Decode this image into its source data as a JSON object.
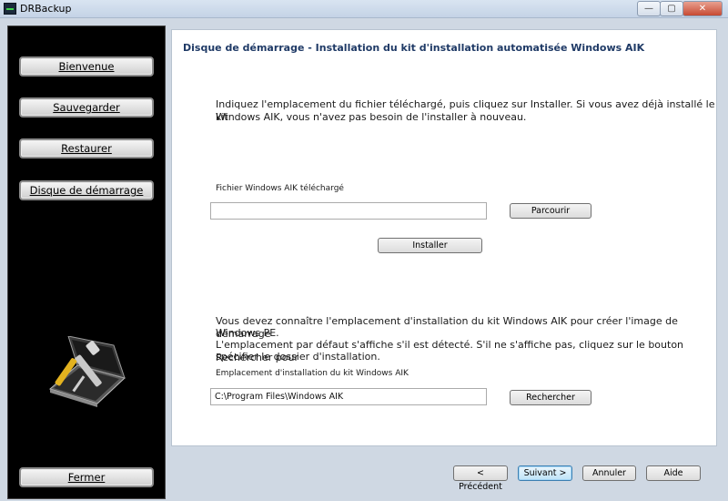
{
  "window": {
    "title": "DRBackup",
    "minimize": "—",
    "maximize": "▢",
    "close": "✕"
  },
  "sidebar": {
    "items": [
      {
        "label": "Bienvenue"
      },
      {
        "label": "Sauvegarder"
      },
      {
        "label": "Restaurer"
      },
      {
        "label": "Disque de démarrage"
      }
    ],
    "close_label": "Fermer"
  },
  "main": {
    "header": "Disque de démarrage - Installation du kit d'installation automatisée Windows AIK",
    "intro_line1": "Indiquez l'emplacement du fichier téléchargé, puis cliquez sur Installer. Si vous avez déjà installé le kit",
    "intro_line2": "Windows AIK, vous n'avez pas besoin de l'installer à nouveau.",
    "download_label": "Fichier Windows AIK téléchargé",
    "download_value": "",
    "browse_label": "Parcourir",
    "install_label": "Installer",
    "location_line1": "Vous devez connaître l'emplacement d'installation du kit Windows AIK pour créer l'image de démarrage",
    "location_line2": "Windows PE.",
    "location_line3": "L'emplacement par défaut s'affiche s'il est détecté. S'il ne s'affiche pas, cliquez sur le bouton Rechercher pour",
    "location_line4": "spécifier le dossier d'installation.",
    "install_location_label": "Emplacement d'installation du kit Windows AIK",
    "install_location_value": "C:\\Program Files\\Windows AIK",
    "search_label": "Rechercher"
  },
  "footer": {
    "previous": "< Précédent",
    "next": "Suivant >",
    "cancel": "Annuler",
    "help": "Aide"
  }
}
